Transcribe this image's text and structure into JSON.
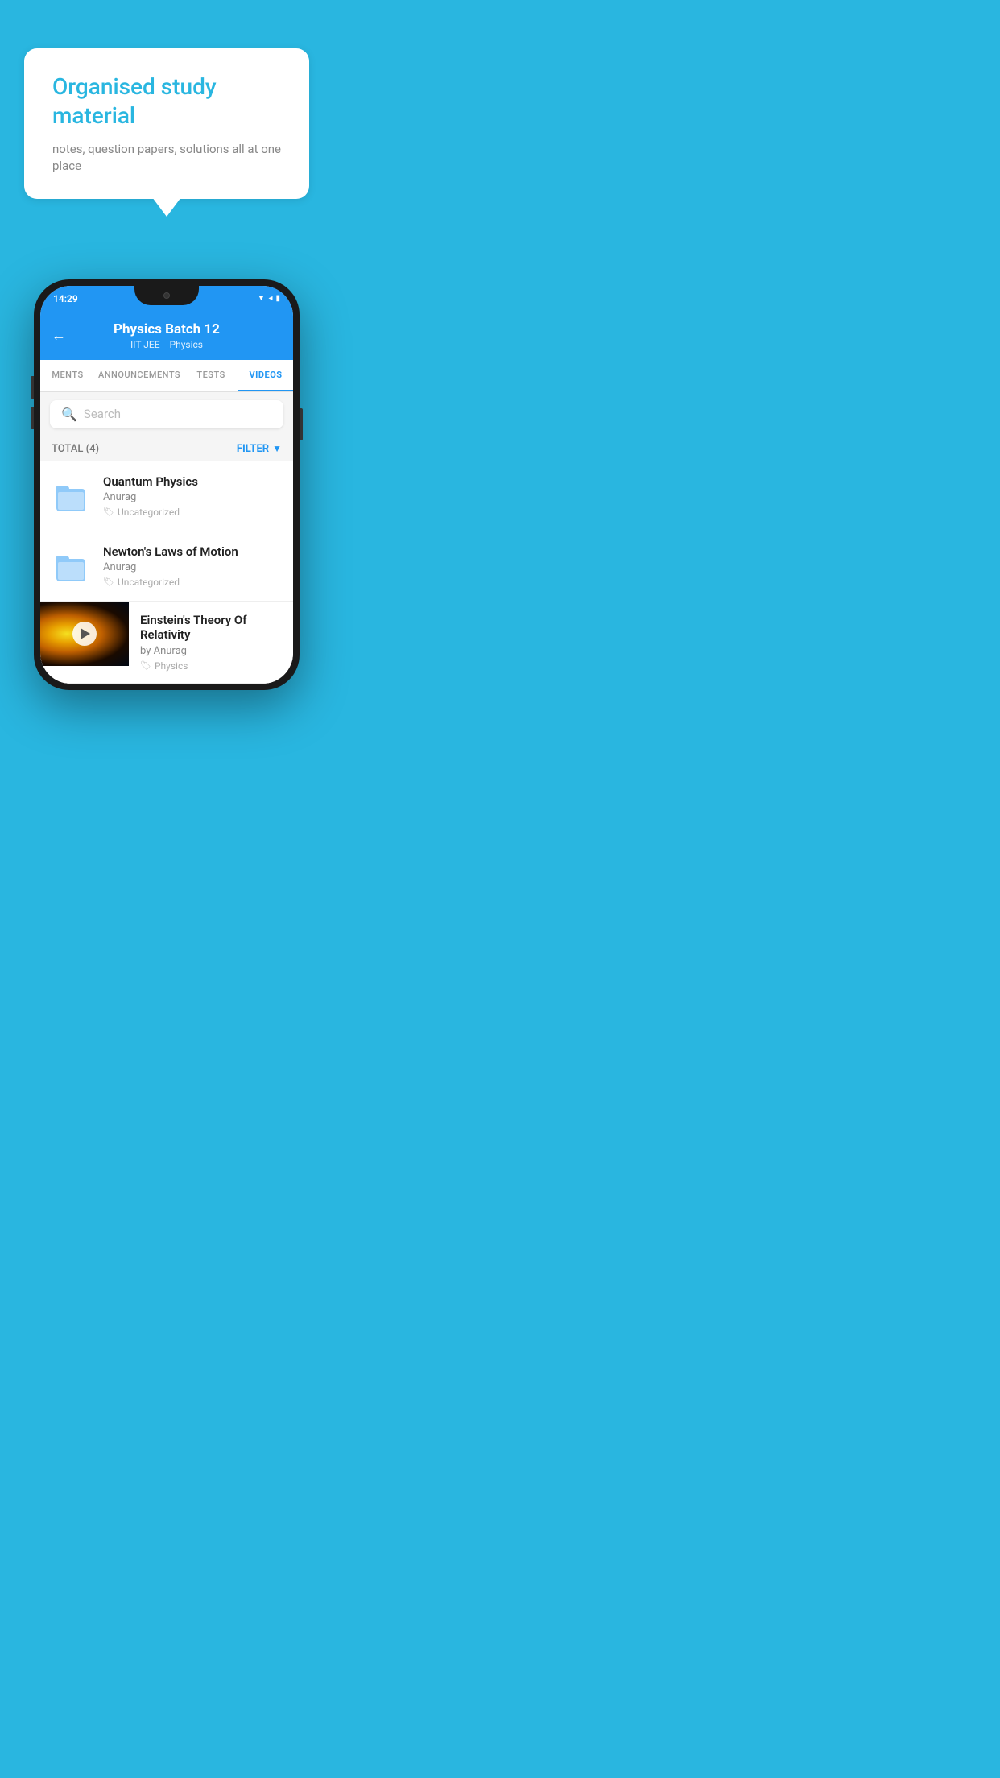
{
  "background_color": "#29b6e0",
  "bubble": {
    "title": "Organised study material",
    "subtitle": "notes, question papers, solutions all at one place"
  },
  "phone": {
    "status_bar": {
      "time": "14:29",
      "icons": "▼◂▮"
    },
    "header": {
      "back_label": "←",
      "title": "Physics Batch 12",
      "subtitle_left": "IIT JEE",
      "subtitle_right": "Physics"
    },
    "tabs": [
      {
        "label": "MENTS",
        "active": false
      },
      {
        "label": "ANNOUNCEMENTS",
        "active": false
      },
      {
        "label": "TESTS",
        "active": false
      },
      {
        "label": "VIDEOS",
        "active": true
      }
    ],
    "search": {
      "placeholder": "Search"
    },
    "filter": {
      "total_label": "TOTAL (4)",
      "button_label": "FILTER"
    },
    "videos": [
      {
        "id": 1,
        "title": "Quantum Physics",
        "author": "Anurag",
        "tag": "Uncategorized",
        "has_thumb": false
      },
      {
        "id": 2,
        "title": "Newton's Laws of Motion",
        "author": "Anurag",
        "tag": "Uncategorized",
        "has_thumb": false
      },
      {
        "id": 3,
        "title": "Einstein's Theory Of Relativity",
        "author": "by Anurag",
        "tag": "Physics",
        "has_thumb": true
      }
    ]
  }
}
